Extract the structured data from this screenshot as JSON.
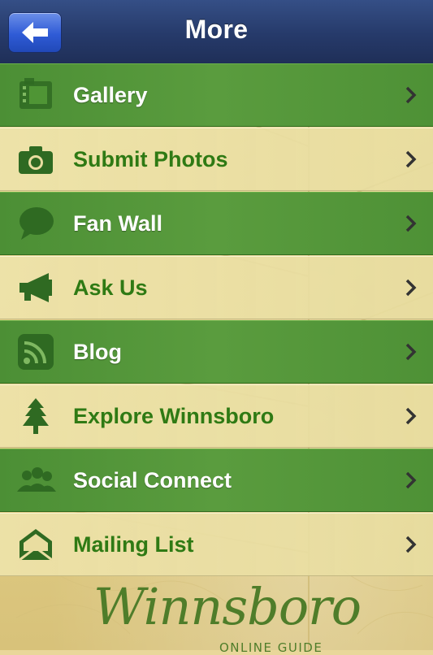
{
  "navbar": {
    "title": "More",
    "back_icon": "arrow-left-icon"
  },
  "menu": {
    "items": [
      {
        "label": "Gallery",
        "icon": "film-strip-icon",
        "style": "dark"
      },
      {
        "label": "Submit Photos",
        "icon": "camera-icon",
        "style": "light"
      },
      {
        "label": "Fan Wall",
        "icon": "speech-bubble-icon",
        "style": "dark"
      },
      {
        "label": "Ask Us",
        "icon": "megaphone-icon",
        "style": "light"
      },
      {
        "label": "Blog",
        "icon": "rss-icon",
        "style": "dark"
      },
      {
        "label": "Explore Winnsboro",
        "icon": "tree-icon",
        "style": "light"
      },
      {
        "label": "Social Connect",
        "icon": "people-icon",
        "style": "dark"
      },
      {
        "label": "Mailing List",
        "icon": "envelope-icon",
        "style": "light"
      }
    ]
  },
  "logo": {
    "script": "Winnsboro",
    "subtitle": "ONLINE GUIDE"
  },
  "colors": {
    "navbar": "#263a6a",
    "back_button": "#2f5bd6",
    "row_dark": "#5a9c3e",
    "row_light": "#e9dda0",
    "label_light": "#2f7a14"
  }
}
